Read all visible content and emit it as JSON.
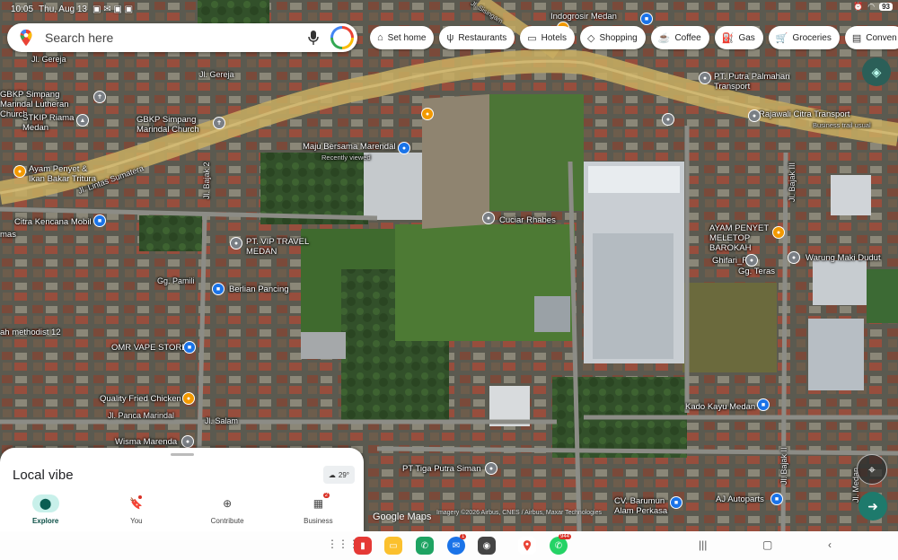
{
  "status_bar": {
    "time": "10:05",
    "date": "Thu, Aug 13",
    "battery": "93"
  },
  "search": {
    "placeholder": "Search here"
  },
  "chips": [
    {
      "icon": "home-icon",
      "label": "Set home"
    },
    {
      "icon": "restaurant-icon",
      "label": "Restaurants"
    },
    {
      "icon": "hotel-icon",
      "label": "Hotels"
    },
    {
      "icon": "shopping-icon",
      "label": "Shopping"
    },
    {
      "icon": "coffee-icon",
      "label": "Coffee"
    },
    {
      "icon": "gas-icon",
      "label": "Gas"
    },
    {
      "icon": "groceries-icon",
      "label": "Groceries"
    },
    {
      "icon": "convenience-icon",
      "label": "Conven"
    }
  ],
  "map_labels": {
    "indogrosir": "Indogrosir Medan",
    "pt_putra": "PT. Putra Palmahan Transport",
    "rajawali": "Rajawali Citra Transport",
    "rajawali_sub": "Business trail usual",
    "gbkp_lutheran": "GBKP Simpang Marindal Lutheran Church",
    "stkip": "STKIP Riama Medan",
    "gbkp_church": "GBKP Simpang Marindal Church",
    "ayam_tritura": "Ayam Penyet & Ikan Bakar Tritura",
    "citra_kencana": "Citra Kencana Mobil",
    "maju_bersama": "Maju Bersama Marendal",
    "recently_viewed": "Recently viewed",
    "cuciar": "Cuciar Rhabes",
    "pt_vip": "PT. VIP TRAVEL MEDAN",
    "berlian": "Berlian Pancing",
    "omr_vape": "OMR VAPE STORE",
    "quality_fried": "Quality Fried Chicken",
    "wisma": "Wisma Marenda",
    "ayam_meletop": "AYAM PENYET MELETOP BAROKAH",
    "ghifari": "Ghifari_RO",
    "teras": "Gg. Teras",
    "warung": "Warung Maki Dudut",
    "kado_kayu": "Kado Kayu Medan",
    "pt_tiga": "PT Tiga Putra Siman",
    "cv_barumun": "CV. Barumun Alam Perkasa",
    "aj_autoparts": "AJ Autoparts",
    "methodist": "ah methodist 12",
    "road_gereja_left": "Jl. Gereja",
    "road_gereja": "Jl. Gereja",
    "road_lintas": "Jl. Lintas Sumatera",
    "road_bajak2": "Jl. Bajak 2",
    "road_pamili": "Gg. Pamili",
    "road_panca": "Jl. Panca Marindal",
    "road_salam": "Jl. Salam",
    "road_bajak3": "Jl. Bajak III",
    "road_bajak_bottom": "Jl. Bajak II",
    "road_sisingamangaraja": "Jl. Sisingam",
    "road_medan": "Jl. Medan",
    "mas": "mas"
  },
  "watermark": "Google Maps",
  "attribution": "Imagery ©2026 Airbus, CNES / Airbus, Maxar Technologies",
  "sheet": {
    "title": "Local vibe",
    "temperature": "29°"
  },
  "nav": [
    {
      "icon": "explore-pin-icon",
      "label": "Explore",
      "active": true
    },
    {
      "icon": "you-bookmark-icon",
      "label": "You"
    },
    {
      "icon": "contribute-plus-icon",
      "label": "Contribute"
    },
    {
      "icon": "business-icon",
      "label": "Business",
      "badge": "2"
    }
  ],
  "taskbar": {
    "messages_badge": "1",
    "whatsapp_badge": "944"
  }
}
